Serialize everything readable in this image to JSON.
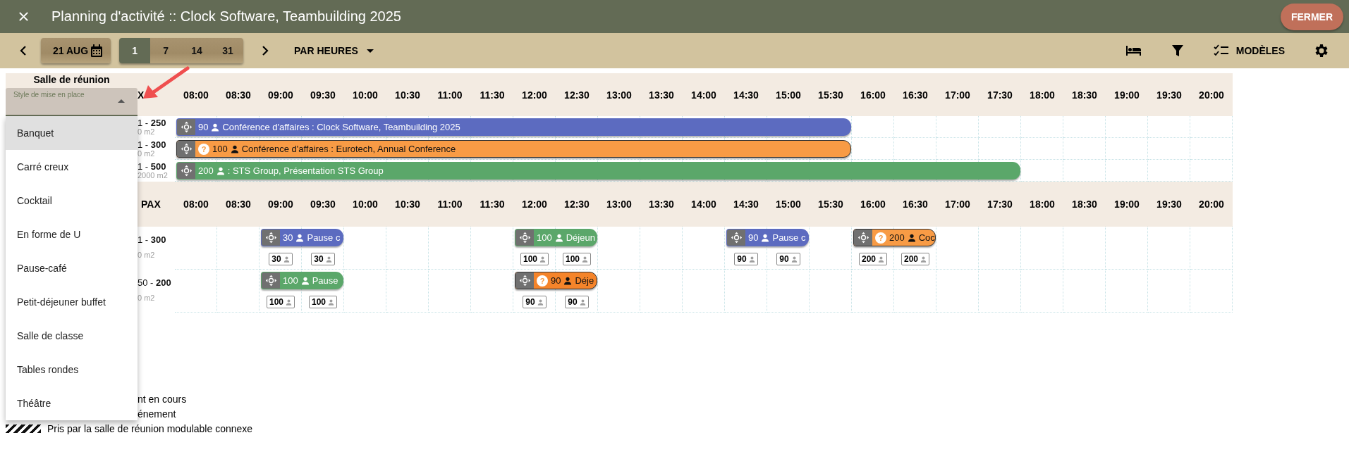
{
  "window": {
    "title": "Planning d'activité :: Clock Software, Teambuilding 2025",
    "close_button": "FERMER"
  },
  "toolbar": {
    "date": "21 AUG",
    "ranges": [
      {
        "label": "1",
        "selected": true
      },
      {
        "label": "7",
        "selected": false
      },
      {
        "label": "14",
        "selected": false
      },
      {
        "label": "31",
        "selected": false
      }
    ],
    "view": "PAR HEURES",
    "templates": "MODÈLES"
  },
  "groups": [
    {
      "header": {
        "room_label": "Salle de réunion",
        "pax_label": "X",
        "times": [
          "08:00",
          "08:30",
          "09:00",
          "09:30",
          "10:00",
          "10:30",
          "11:00",
          "11:30",
          "12:00",
          "12:30",
          "13:00",
          "13:30",
          "14:00",
          "14:30",
          "15:00",
          "15:30",
          "16:00",
          "16:30",
          "17:00",
          "17:30",
          "18:00",
          "18:30",
          "19:00",
          "19:30",
          "20:00"
        ]
      },
      "rows": [
        {
          "capacity": "1 - **250**",
          "area": "0 m2",
          "slots": [
            {
              "kind": "event",
              "count": "90",
              "title": "Conférence d'affaires : Clock Software, Teambuilding 2025",
              "color": "#5c6bc0",
              "tentative": false
            },
            {
              "kind": "cont"
            },
            {
              "kind": "cont"
            },
            {
              "kind": "cont"
            },
            {
              "kind": "cont"
            },
            {
              "kind": "cont"
            },
            {
              "kind": "cont"
            },
            {
              "kind": "cont"
            },
            {
              "kind": "cont"
            },
            {
              "kind": "cont"
            },
            {
              "kind": "cont"
            },
            {
              "kind": "cont"
            },
            {
              "kind": "cont"
            },
            {
              "kind": "cont"
            },
            {
              "kind": "cont"
            },
            {
              "kind": "cont"
            },
            {
              "kind": "free"
            },
            {
              "kind": "free"
            },
            {
              "kind": "free"
            },
            {
              "kind": "free"
            },
            {
              "kind": "free"
            },
            {
              "kind": "free"
            },
            {
              "kind": "free"
            },
            {
              "kind": "free"
            },
            {
              "kind": "free"
            }
          ]
        },
        {
          "capacity": "1 - **300**",
          "area": "0 m2",
          "slots": [
            {
              "kind": "event",
              "count": "100",
              "title": "Conférence d'affaires : Eurotech, Annual Conference",
              "color": "#f89b45",
              "tentative": true,
              "badge": "?"
            },
            {
              "kind": "cont"
            },
            {
              "kind": "cont"
            },
            {
              "kind": "cont"
            },
            {
              "kind": "cont"
            },
            {
              "kind": "cont"
            },
            {
              "kind": "cont"
            },
            {
              "kind": "cont"
            },
            {
              "kind": "cont"
            },
            {
              "kind": "cont"
            },
            {
              "kind": "cont"
            },
            {
              "kind": "cont"
            },
            {
              "kind": "cont"
            },
            {
              "kind": "cont"
            },
            {
              "kind": "cont"
            },
            {
              "kind": "cont"
            },
            {
              "kind": "free"
            },
            {
              "kind": "free"
            },
            {
              "kind": "free"
            },
            {
              "kind": "free"
            },
            {
              "kind": "free"
            },
            {
              "kind": "free"
            },
            {
              "kind": "free"
            },
            {
              "kind": "free"
            },
            {
              "kind": "free"
            }
          ]
        },
        {
          "capacity": "1 - **500**",
          "area": "2000 m2",
          "slots": [
            {
              "kind": "event",
              "count": "200",
              "title": ": STS Group, Présentation STS Group",
              "color": "#5ba76a",
              "tentative": false
            },
            {
              "kind": "cont"
            },
            {
              "kind": "cont"
            },
            {
              "kind": "cont"
            },
            {
              "kind": "cont"
            },
            {
              "kind": "cont"
            },
            {
              "kind": "cont"
            },
            {
              "kind": "cont"
            },
            {
              "kind": "cont"
            },
            {
              "kind": "cont"
            },
            {
              "kind": "cont"
            },
            {
              "kind": "cont"
            },
            {
              "kind": "cont"
            },
            {
              "kind": "cont"
            },
            {
              "kind": "cont"
            },
            {
              "kind": "cont"
            },
            {
              "kind": "cont"
            },
            {
              "kind": "cont"
            },
            {
              "kind": "cont"
            },
            {
              "kind": "cont"
            },
            {
              "kind": "free"
            },
            {
              "kind": "free"
            },
            {
              "kind": "free"
            },
            {
              "kind": "free"
            },
            {
              "kind": "free"
            }
          ]
        }
      ]
    },
    {
      "header": {
        "pax_label": "PAX",
        "times": [
          "08:00",
          "08:30",
          "09:00",
          "09:30",
          "10:00",
          "10:30",
          "11:00",
          "11:30",
          "12:00",
          "12:30",
          "13:00",
          "13:30",
          "14:00",
          "14:30",
          "15:00",
          "15:30",
          "16:00",
          "16:30",
          "17:00",
          "17:30",
          "18:00",
          "18:30",
          "19:00",
          "19:30",
          "20:00"
        ]
      },
      "rows": [
        {
          "capacity": "1 - **300**",
          "area": "0 m2",
          "slots": [
            {
              "kind": "free"
            },
            {
              "kind": "free"
            },
            {
              "kind": "event",
              "count": "30",
              "title": "Pause c",
              "color": "#5c6bc0",
              "tentative": false,
              "count_badge": "30"
            },
            {
              "kind": "cont",
              "count_badge": "30"
            },
            {
              "kind": "free"
            },
            {
              "kind": "free"
            },
            {
              "kind": "free"
            },
            {
              "kind": "free"
            },
            {
              "kind": "event",
              "count": "100",
              "title": "Déjeun",
              "color": "#5ba76a",
              "tentative": false,
              "count_badge": "100"
            },
            {
              "kind": "cont",
              "count_badge": "100"
            },
            {
              "kind": "free"
            },
            {
              "kind": "free"
            },
            {
              "kind": "free"
            },
            {
              "kind": "event",
              "count": "90",
              "title": "Pause c",
              "color": "#5c6bc0",
              "tentative": false,
              "count_badge": "90"
            },
            {
              "kind": "cont",
              "count_badge": "90"
            },
            {
              "kind": "free"
            },
            {
              "kind": "event",
              "count": "200",
              "title": "Coc",
              "color": "#f89b45",
              "tentative": true,
              "badge": "?",
              "count_badge": "200"
            },
            {
              "kind": "cont",
              "count_badge": "200"
            },
            {
              "kind": "free"
            },
            {
              "kind": "free"
            },
            {
              "kind": "free"
            },
            {
              "kind": "free"
            },
            {
              "kind": "free"
            },
            {
              "kind": "free"
            },
            {
              "kind": "free"
            }
          ]
        },
        {
          "capacity": "50 - **200**",
          "area": "0 m2",
          "slots": [
            {
              "kind": "free"
            },
            {
              "kind": "free"
            },
            {
              "kind": "event",
              "count": "100",
              "title": "Pause",
              "color": "#5ba76a",
              "tentative": false,
              "count_badge": "100"
            },
            {
              "kind": "cont",
              "count_badge": "100"
            },
            {
              "kind": "free"
            },
            {
              "kind": "free"
            },
            {
              "kind": "free"
            },
            {
              "kind": "free"
            },
            {
              "kind": "event",
              "count": "90",
              "title": "Déje",
              "color": "#f5842a",
              "tentative": true,
              "badge": "?",
              "count_badge": "90"
            },
            {
              "kind": "cont",
              "count_badge": "90"
            },
            {
              "kind": "free"
            },
            {
              "kind": "free"
            },
            {
              "kind": "free"
            },
            {
              "kind": "free"
            },
            {
              "kind": "free"
            },
            {
              "kind": "free"
            },
            {
              "kind": "free"
            },
            {
              "kind": "free"
            },
            {
              "kind": "free"
            },
            {
              "kind": "free"
            },
            {
              "kind": "free"
            },
            {
              "kind": "free"
            },
            {
              "kind": "free"
            },
            {
              "kind": "free"
            },
            {
              "kind": "free"
            }
          ]
        }
      ]
    }
  ],
  "legend": [
    {
      "kind": "clipped",
      "label": "nt en cours"
    },
    {
      "kind": "clipped",
      "label": "énement"
    },
    {
      "kind": "hatched",
      "label": "Pris par la salle de réunion modulable connexe"
    }
  ],
  "layout_select": {
    "label": "Style de mise en place",
    "options": [
      {
        "label": "Banquet",
        "selected": true
      },
      {
        "label": "Carré creux",
        "selected": false
      },
      {
        "label": "Cocktail",
        "selected": false
      },
      {
        "label": "En forme de U",
        "selected": false
      },
      {
        "label": "Pause-café",
        "selected": false
      },
      {
        "label": "Petit-déjeuner buffet",
        "selected": false
      },
      {
        "label": "Salle de classe",
        "selected": false
      },
      {
        "label": "Tables rondes",
        "selected": false
      },
      {
        "label": "Théâtre",
        "selected": false
      }
    ]
  }
}
